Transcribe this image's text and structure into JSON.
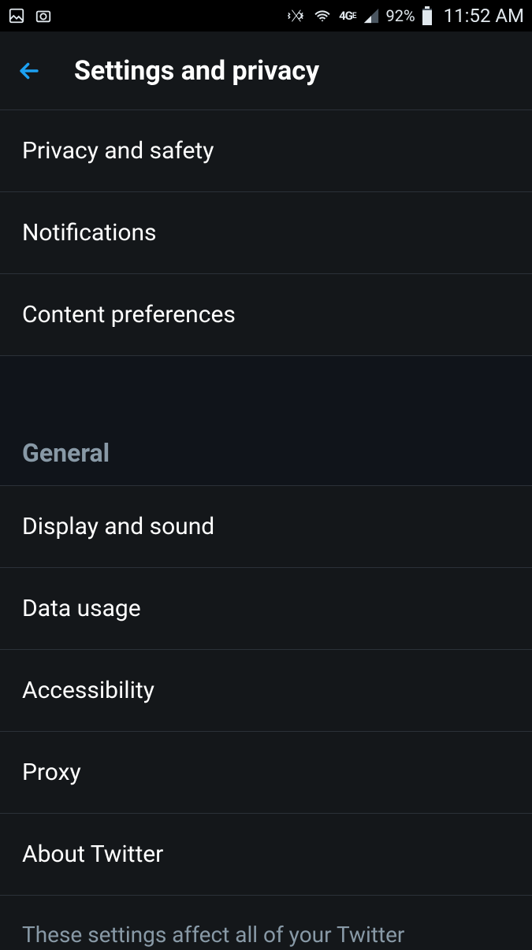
{
  "statusBar": {
    "batteryPct": "92%",
    "time": "11:52 AM",
    "networkLabel": "4G"
  },
  "appBar": {
    "title": "Settings and privacy"
  },
  "topItems": [
    {
      "label": "Privacy and safety"
    },
    {
      "label": "Notifications"
    },
    {
      "label": "Content preferences"
    }
  ],
  "sectionHeader": "General",
  "generalItems": [
    {
      "label": "Display and sound"
    },
    {
      "label": "Data usage"
    },
    {
      "label": "Accessibility"
    },
    {
      "label": "Proxy"
    },
    {
      "label": "About Twitter"
    }
  ],
  "footerText": "These settings affect all of your Twitter"
}
